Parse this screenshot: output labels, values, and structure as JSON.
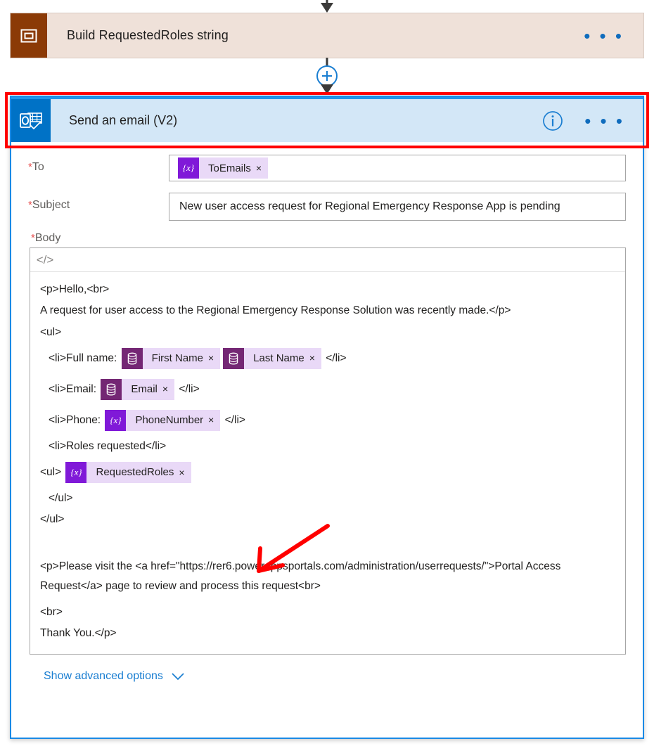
{
  "flow": {
    "previous_action": {
      "title": "Build RequestedRoles string",
      "icon": "variable-icon",
      "icon_color": "#8b3a06",
      "card_color": "#efe1d9",
      "ellipsis": "• • •"
    },
    "add_step_button": "+",
    "selected_action": {
      "title": "Send an email (V2)",
      "icon": "outlook-icon",
      "icon_color": "#0072c6",
      "header_color": "#d3e7f7",
      "selection_border_color": "#1a8ae5",
      "info_icon": "info-circle-icon",
      "ellipsis": "• • •"
    }
  },
  "annotation": {
    "highlight_color": "#ff0000",
    "arrow_color": "#ff0000"
  },
  "form": {
    "to": {
      "label": "To",
      "required_marker": "*",
      "tokens": [
        {
          "icon": "variable-token-icon",
          "glyph": "{x}",
          "kind": "var",
          "text": "ToEmails",
          "remove": "×"
        }
      ]
    },
    "subject": {
      "label": "Subject",
      "required_marker": "*",
      "value": "New user access request for Regional Emergency Response App is pending"
    },
    "body": {
      "label": "Body",
      "required_marker": "*",
      "toolbar": {
        "code_view_button": "</>"
      },
      "lines": [
        {
          "id": "l1",
          "text": "<p>Hello,<br>"
        },
        {
          "id": "l2",
          "text": "A request for user access to the Regional Emergency Response Solution was recently made.</p>"
        },
        {
          "id": "l3",
          "text": "<ul>"
        },
        {
          "id": "l4",
          "pre": "<li>Full name:",
          "post": "</li>",
          "indent": true,
          "tokens": [
            {
              "glyph": "⛁",
              "kind": "data",
              "text": "First Name",
              "remove": "×"
            },
            {
              "glyph": "⛁",
              "kind": "data",
              "text": "Last Name",
              "remove": "×"
            }
          ]
        },
        {
          "id": "l5",
          "pre": "<li>Email:",
          "post": "</li>",
          "indent": true,
          "tokens": [
            {
              "glyph": "⛁",
              "kind": "data",
              "text": "Email",
              "remove": "×"
            }
          ]
        },
        {
          "id": "l6",
          "pre": "<li>Phone:",
          "post": "</li>",
          "indent": true,
          "tokens": [
            {
              "glyph": "{x}",
              "kind": "var",
              "text": "PhoneNumber",
              "remove": "×"
            }
          ]
        },
        {
          "id": "l7",
          "text": "<li>Roles requested</li>",
          "indent": true
        },
        {
          "id": "l8",
          "pre": "<ul>",
          "post": "",
          "tokens": [
            {
              "glyph": "{x}",
              "kind": "var",
              "text": "RequestedRoles",
              "remove": "×"
            }
          ]
        },
        {
          "id": "l9",
          "text": "</ul>",
          "indent": true
        },
        {
          "id": "l10",
          "text": "</ul>"
        },
        {
          "id": "l11",
          "text": "<p>Please visit the <a href=\"https://rer6.powerappsportals.com/administration/userrequests/\">Portal Access Request</a> page to review and process this request<br>",
          "wrapped": true
        },
        {
          "id": "l12",
          "text": "<br>"
        },
        {
          "id": "l13",
          "text": "Thank You.</p>"
        }
      ]
    },
    "advanced": {
      "label": "Show advanced options",
      "chevron": "chevron-down-icon"
    }
  }
}
